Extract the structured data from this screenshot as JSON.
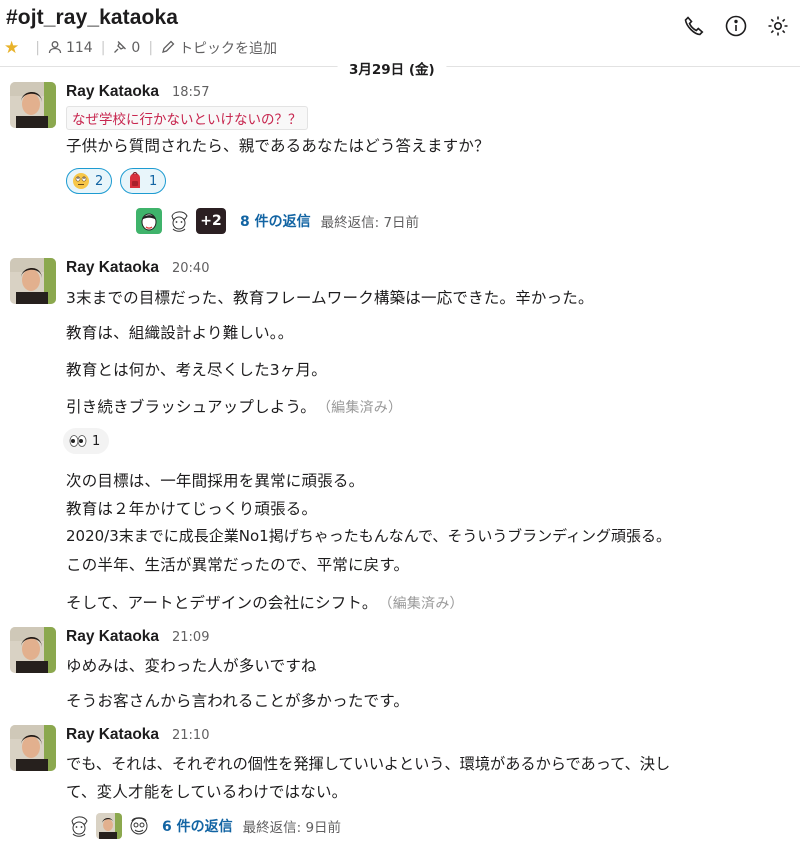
{
  "header": {
    "channel": "#ojt_ray_kataoka",
    "members": "114",
    "pins": "0",
    "topic_label": "トピックを追加"
  },
  "date_divider": "3月29日 (金)",
  "messages": [
    {
      "author": "Ray Kataoka",
      "time": "18:57",
      "code": "なぜ学校に行かないといけないの？？",
      "lines": [
        "子供から質問されたら、親であるあなたはどう答えますか？"
      ],
      "reactions": [
        {
          "emoji": "rolling-eyes-face",
          "count": "2"
        },
        {
          "emoji": "school-backpack",
          "count": "1"
        }
      ],
      "thread": {
        "extra": "+2",
        "replies": "8 件の返信",
        "last": "最終返信: 7日前"
      }
    },
    {
      "author": "Ray Kataoka",
      "time": "20:40",
      "lines": [
        "3末までの目標だった、教育フレームワーク構築は一応できた。辛かった。",
        "教育は、組織設計より難しい。。",
        "教育とは何か、考え尽くした3ヶ月。",
        "引き続きブラッシュアップしよう。"
      ],
      "edited": "（編集済み）",
      "reactions": [
        {
          "emoji": "eyes",
          "count": "1"
        }
      ],
      "lines2": [
        "次の目標は、一年間採用を異常に頑張る。",
        "教育は２年かけてじっくり頑張る。",
        "2020/3末までに成長企業No1掲げちゃったもんなんで、そういうブランディング頑張る。",
        "この半年、生活が異常だったので、平常に戻す。",
        "そして、アートとデザインの会社にシフト。"
      ],
      "edited2": "（編集済み）"
    },
    {
      "author": "Ray Kataoka",
      "time": "21:09",
      "lines": [
        "ゆめみは、変わった人が多いですね",
        "そうお客さんから言われることが多かったです。"
      ]
    },
    {
      "author": "Ray Kataoka",
      "time": "21:10",
      "lines": [
        "でも、それは、それぞれの個性を発揮していいよという、環境があるからであって、決し",
        "て、変人才能をしているわけではない。"
      ],
      "thread": {
        "replies": "6 件の返信",
        "last": "最終返信: 9日前"
      }
    }
  ]
}
